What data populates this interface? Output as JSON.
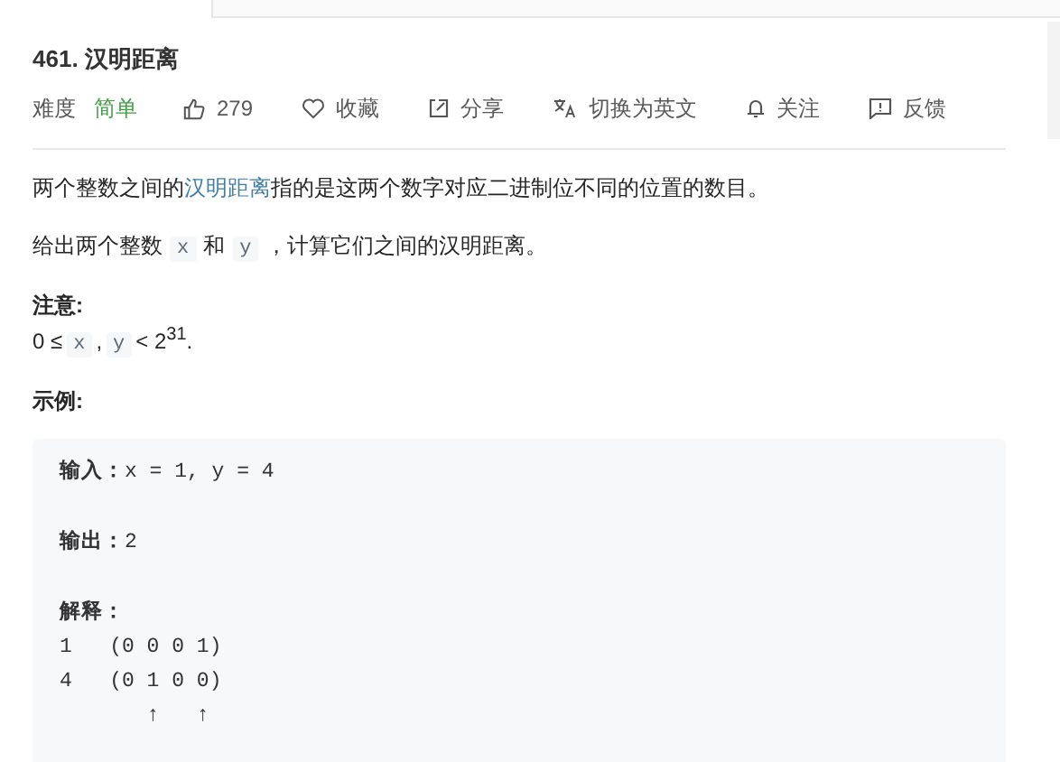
{
  "title": "461. 汉明距离",
  "meta": {
    "difficulty_label": "难度",
    "difficulty": "简单",
    "actions": [
      {
        "kind": "like",
        "label": "279"
      },
      {
        "kind": "favorite",
        "label": "收藏"
      },
      {
        "kind": "share",
        "label": "分享"
      },
      {
        "kind": "translate",
        "label": "切换为英文"
      },
      {
        "kind": "follow",
        "label": "关注"
      },
      {
        "kind": "feedback",
        "label": "反馈"
      }
    ]
  },
  "description": [
    [
      {
        "kind": "text",
        "text": "两个整数之间的"
      },
      {
        "kind": "link",
        "text": "汉明距离"
      },
      {
        "kind": "text",
        "text": "指的是这两个数字对应二进制位不同的位置的数目。"
      }
    ],
    [
      {
        "kind": "text",
        "text": "给出两个整数"
      },
      {
        "kind": "code",
        "text": "x"
      },
      {
        "kind": "text",
        "text": "和"
      },
      {
        "kind": "code",
        "text": "y"
      },
      {
        "kind": "text",
        "text": "，计算它们之间的汉明距离。"
      }
    ]
  ],
  "note": {
    "heading": "注意:",
    "constraint": [
      {
        "kind": "text",
        "text": "0 ≤"
      },
      {
        "kind": "code",
        "text": "x"
      },
      {
        "kind": "text",
        "text": ","
      },
      {
        "kind": "code",
        "text": "y"
      },
      {
        "kind": "text",
        "text": "< 2$^{31}$."
      }
    ]
  },
  "example": {
    "heading": "示例:",
    "sections": [
      {
        "label": "输入：",
        "lines": [
          "x = 1, y = 4"
        ]
      },
      {
        "label": "输出：",
        "lines": [
          "2"
        ]
      },
      {
        "label": "解释：",
        "lines": [
          "1   (0 0 0 1)",
          "4   (0 1 0 0)",
          "       ↑   ↑"
        ]
      }
    ]
  }
}
